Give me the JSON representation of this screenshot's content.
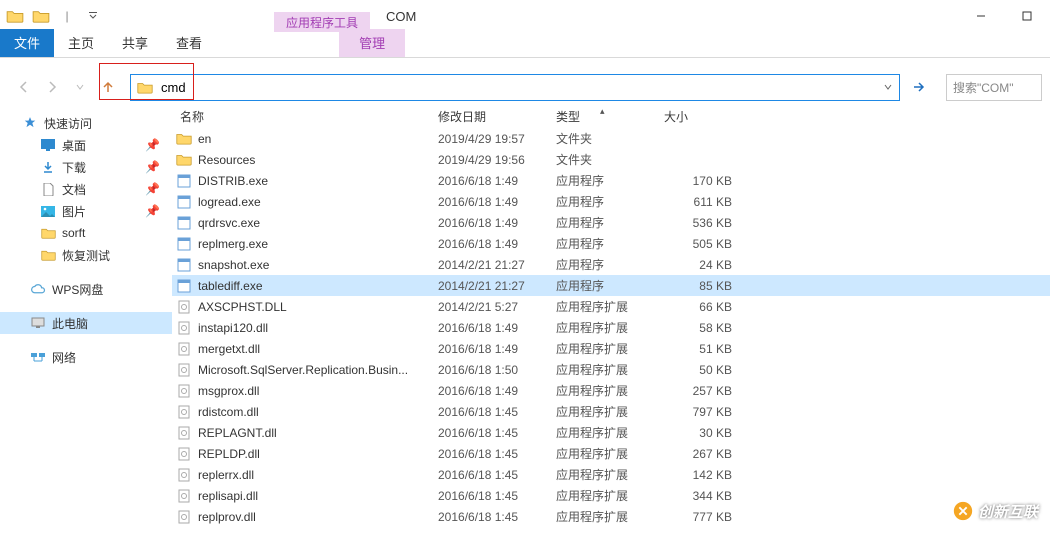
{
  "title": {
    "tool_label": "应用程序工具",
    "header": "COM"
  },
  "tabs": {
    "file": "文件",
    "home": "主页",
    "share": "共享",
    "view": "查看",
    "manage": "管理"
  },
  "nav": {
    "address_value": "cmd",
    "search_placeholder": "搜索\"COM\""
  },
  "columns": {
    "name": "名称",
    "date": "修改日期",
    "type": "类型",
    "size": "大小"
  },
  "sidebar": {
    "quick": "快速访问",
    "desktop": "桌面",
    "downloads": "下载",
    "documents": "文档",
    "pictures": "图片",
    "sorft": "sorft",
    "recover": "恢复测试",
    "wps": "WPS网盘",
    "thispc": "此电脑",
    "network": "网络"
  },
  "files": [
    {
      "name": "en",
      "date": "2019/4/29 19:57",
      "type": "文件夹",
      "size": "",
      "kind": "folder"
    },
    {
      "name": "Resources",
      "date": "2019/4/29 19:56",
      "type": "文件夹",
      "size": "",
      "kind": "folder"
    },
    {
      "name": "DISTRIB.exe",
      "date": "2016/6/18 1:49",
      "type": "应用程序",
      "size": "170 KB",
      "kind": "exe"
    },
    {
      "name": "logread.exe",
      "date": "2016/6/18 1:49",
      "type": "应用程序",
      "size": "611 KB",
      "kind": "exe"
    },
    {
      "name": "qrdrsvc.exe",
      "date": "2016/6/18 1:49",
      "type": "应用程序",
      "size": "536 KB",
      "kind": "exe"
    },
    {
      "name": "replmerg.exe",
      "date": "2016/6/18 1:49",
      "type": "应用程序",
      "size": "505 KB",
      "kind": "exe"
    },
    {
      "name": "snapshot.exe",
      "date": "2014/2/21 21:27",
      "type": "应用程序",
      "size": "24 KB",
      "kind": "exe"
    },
    {
      "name": "tablediff.exe",
      "date": "2014/2/21 21:27",
      "type": "应用程序",
      "size": "85 KB",
      "kind": "exe",
      "selected": true
    },
    {
      "name": "AXSCPHST.DLL",
      "date": "2014/2/21 5:27",
      "type": "应用程序扩展",
      "size": "66 KB",
      "kind": "dll"
    },
    {
      "name": "instapi120.dll",
      "date": "2016/6/18 1:49",
      "type": "应用程序扩展",
      "size": "58 KB",
      "kind": "dll"
    },
    {
      "name": "mergetxt.dll",
      "date": "2016/6/18 1:49",
      "type": "应用程序扩展",
      "size": "51 KB",
      "kind": "dll"
    },
    {
      "name": "Microsoft.SqlServer.Replication.Busin...",
      "date": "2016/6/18 1:50",
      "type": "应用程序扩展",
      "size": "50 KB",
      "kind": "dll"
    },
    {
      "name": "msgprox.dll",
      "date": "2016/6/18 1:49",
      "type": "应用程序扩展",
      "size": "257 KB",
      "kind": "dll"
    },
    {
      "name": "rdistcom.dll",
      "date": "2016/6/18 1:45",
      "type": "应用程序扩展",
      "size": "797 KB",
      "kind": "dll"
    },
    {
      "name": "REPLAGNT.dll",
      "date": "2016/6/18 1:45",
      "type": "应用程序扩展",
      "size": "30 KB",
      "kind": "dll"
    },
    {
      "name": "REPLDP.dll",
      "date": "2016/6/18 1:45",
      "type": "应用程序扩展",
      "size": "267 KB",
      "kind": "dll"
    },
    {
      "name": "replerrx.dll",
      "date": "2016/6/18 1:45",
      "type": "应用程序扩展",
      "size": "142 KB",
      "kind": "dll"
    },
    {
      "name": "replisapi.dll",
      "date": "2016/6/18 1:45",
      "type": "应用程序扩展",
      "size": "344 KB",
      "kind": "dll"
    },
    {
      "name": "replprov.dll",
      "date": "2016/6/18 1:45",
      "type": "应用程序扩展",
      "size": "777 KB",
      "kind": "dll"
    }
  ],
  "watermark": "创新互联"
}
